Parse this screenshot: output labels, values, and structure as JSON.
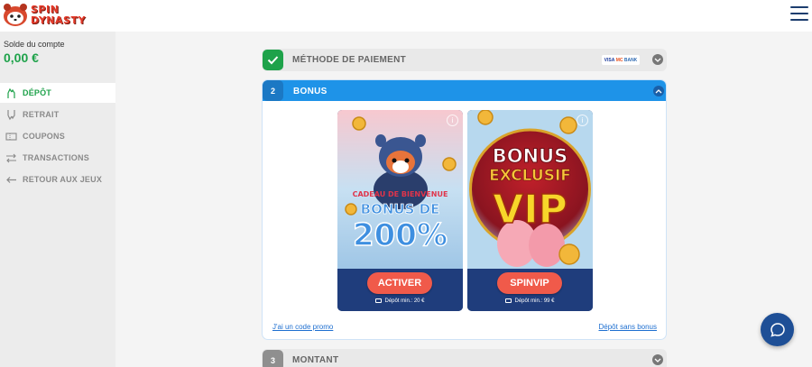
{
  "brand": {
    "line1": "SPIN",
    "line2": "DYNASTY"
  },
  "sidebar": {
    "balance_label": "Solde du compte",
    "balance_value": "0,00 €",
    "items": [
      {
        "label": "DÉPÔT",
        "icon": "deposit-hand-icon",
        "active": true
      },
      {
        "label": "RETRAIT",
        "icon": "withdraw-hand-icon",
        "active": false
      },
      {
        "label": "COUPONS",
        "icon": "coupon-ticket-icon",
        "active": false
      },
      {
        "label": "TRANSACTIONS",
        "icon": "transfer-arrows-icon",
        "active": false
      },
      {
        "label": "RETOUR AUX JEUX",
        "icon": "back-arrow-icon",
        "active": false
      }
    ]
  },
  "steps": {
    "payment": {
      "title": "MÉTHODE DE PAIEMENT",
      "logos": [
        "VISA",
        "MC",
        "BANK"
      ]
    },
    "bonus": {
      "number": "2",
      "title": "BONUS"
    },
    "amount": {
      "number": "3",
      "title": "MONTANT"
    }
  },
  "cards": [
    {
      "banner_small": "CADEAU DE BIENVENUE",
      "banner_big_1": "BONUS DE",
      "banner_big_2": "200%",
      "button": "ACTIVER",
      "min_deposit": "Dépôt min.: 20 €"
    },
    {
      "banner_small": "BONUS",
      "banner_big_1": "EXCLUSIF",
      "banner_big_2": "VIP",
      "button": "SPINVIP",
      "min_deposit": "Dépôt min.: 99 €"
    }
  ],
  "links": {
    "promo": "J'ai un code promo",
    "no_bonus": "Dépôt sans bonus"
  },
  "colors": {
    "accent_green": "#1ea24a",
    "accent_blue": "#1e93e8",
    "cta_red": "#f05a4a",
    "card_footer": "#1f3d7c"
  }
}
